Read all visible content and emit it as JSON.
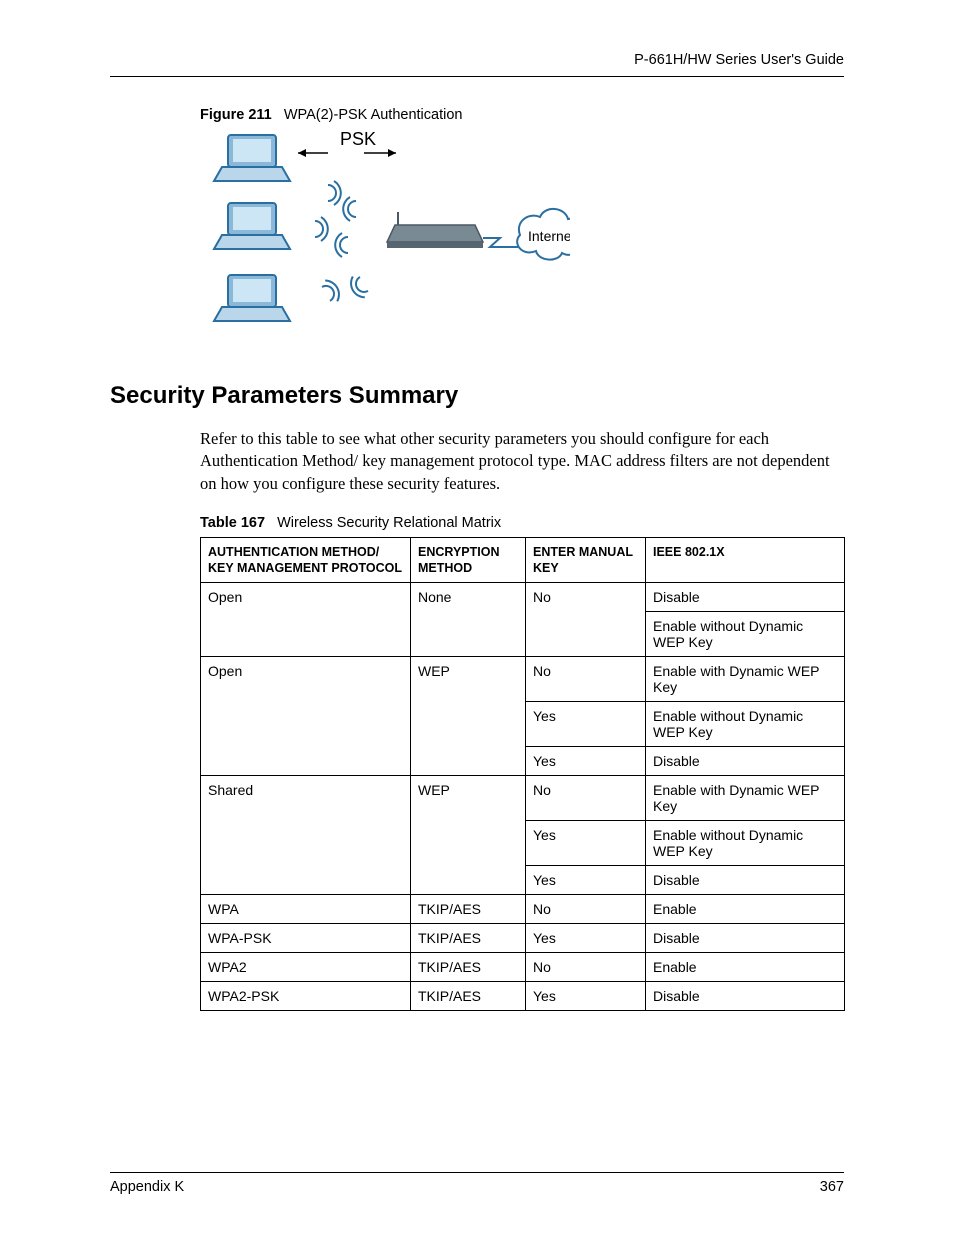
{
  "header": {
    "doc_title": "P-661H/HW Series User's Guide"
  },
  "figure": {
    "label_bold": "Figure 211",
    "label_rest": "WPA(2)-PSK Authentication",
    "psk_label": "PSK",
    "internet_label": "Internet"
  },
  "section": {
    "heading": "Security Parameters Summary",
    "paragraph": "Refer to this table to see what other security parameters you should configure for each Authentication Method/ key management protocol type. MAC address filters are not dependent on how you configure these security features."
  },
  "table": {
    "caption_bold": "Table 167",
    "caption_rest": "Wireless Security Relational Matrix",
    "headers": {
      "auth": "AUTHENTICATION METHOD/ KEY MANAGEMENT PROTOCOL",
      "enc": "ENCRYPTION METHOD",
      "manual": "ENTER MANUAL KEY",
      "ieee": "IEEE 802.1X"
    },
    "groups": [
      {
        "auth": "Open",
        "enc": "None",
        "rows": [
          {
            "manual": "No",
            "ieee": "Disable"
          },
          {
            "manual": "",
            "ieee": "Enable without Dynamic WEP Key"
          }
        ]
      },
      {
        "auth": "Open",
        "enc": "WEP",
        "rows": [
          {
            "manual": "No",
            "ieee": "Enable with Dynamic WEP Key"
          },
          {
            "manual": "Yes",
            "ieee": "Enable without Dynamic WEP Key"
          },
          {
            "manual": "Yes",
            "ieee": "Disable"
          }
        ]
      },
      {
        "auth": "Shared",
        "enc": "WEP",
        "rows": [
          {
            "manual": "No",
            "ieee": "Enable with Dynamic WEP Key"
          },
          {
            "manual": "Yes",
            "ieee": "Enable without Dynamic WEP Key"
          },
          {
            "manual": "Yes",
            "ieee": "Disable"
          }
        ]
      },
      {
        "auth": "WPA",
        "enc": "TKIP/AES",
        "rows": [
          {
            "manual": "No",
            "ieee": "Enable"
          }
        ]
      },
      {
        "auth": "WPA-PSK",
        "enc": "TKIP/AES",
        "rows": [
          {
            "manual": "Yes",
            "ieee": "Disable"
          }
        ]
      },
      {
        "auth": "WPA2",
        "enc": "TKIP/AES",
        "rows": [
          {
            "manual": "No",
            "ieee": "Enable"
          }
        ]
      },
      {
        "auth": "WPA2-PSK",
        "enc": "TKIP/AES",
        "rows": [
          {
            "manual": "Yes",
            "ieee": "Disable"
          }
        ]
      }
    ]
  },
  "footer": {
    "left": "Appendix K",
    "right": "367"
  }
}
